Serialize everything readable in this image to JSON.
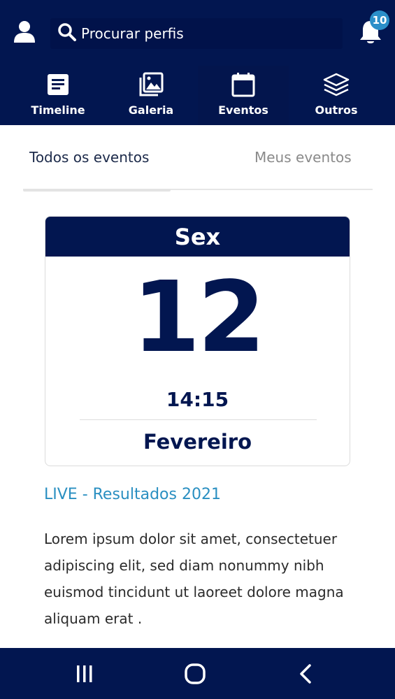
{
  "header": {
    "search_placeholder": "Procurar perfis",
    "notifications_count": "10"
  },
  "nav": {
    "tabs": [
      {
        "label": "Timeline",
        "icon": "document-icon"
      },
      {
        "label": "Galeria",
        "icon": "gallery-icon"
      },
      {
        "label": "Eventos",
        "icon": "calendar-icon",
        "active": true
      },
      {
        "label": "Outros",
        "icon": "layers-icon"
      }
    ]
  },
  "segments": {
    "all": "Todos os eventos",
    "mine": "Meus eventos",
    "active": "all"
  },
  "event": {
    "weekday": "Sex",
    "day": "12",
    "time": "14:15",
    "month": "Fevereiro",
    "title": "LIVE - Resultados 2021",
    "description": "Lorem ipsum dolor sit amet, consectetuer adipiscing elit, sed diam nonummy nibh euismod tincidunt ut laoreet dolore magna aliquam erat ."
  },
  "colors": {
    "primary": "#021650",
    "accent": "#2a8fc1",
    "badge": "#2b8fc9"
  }
}
